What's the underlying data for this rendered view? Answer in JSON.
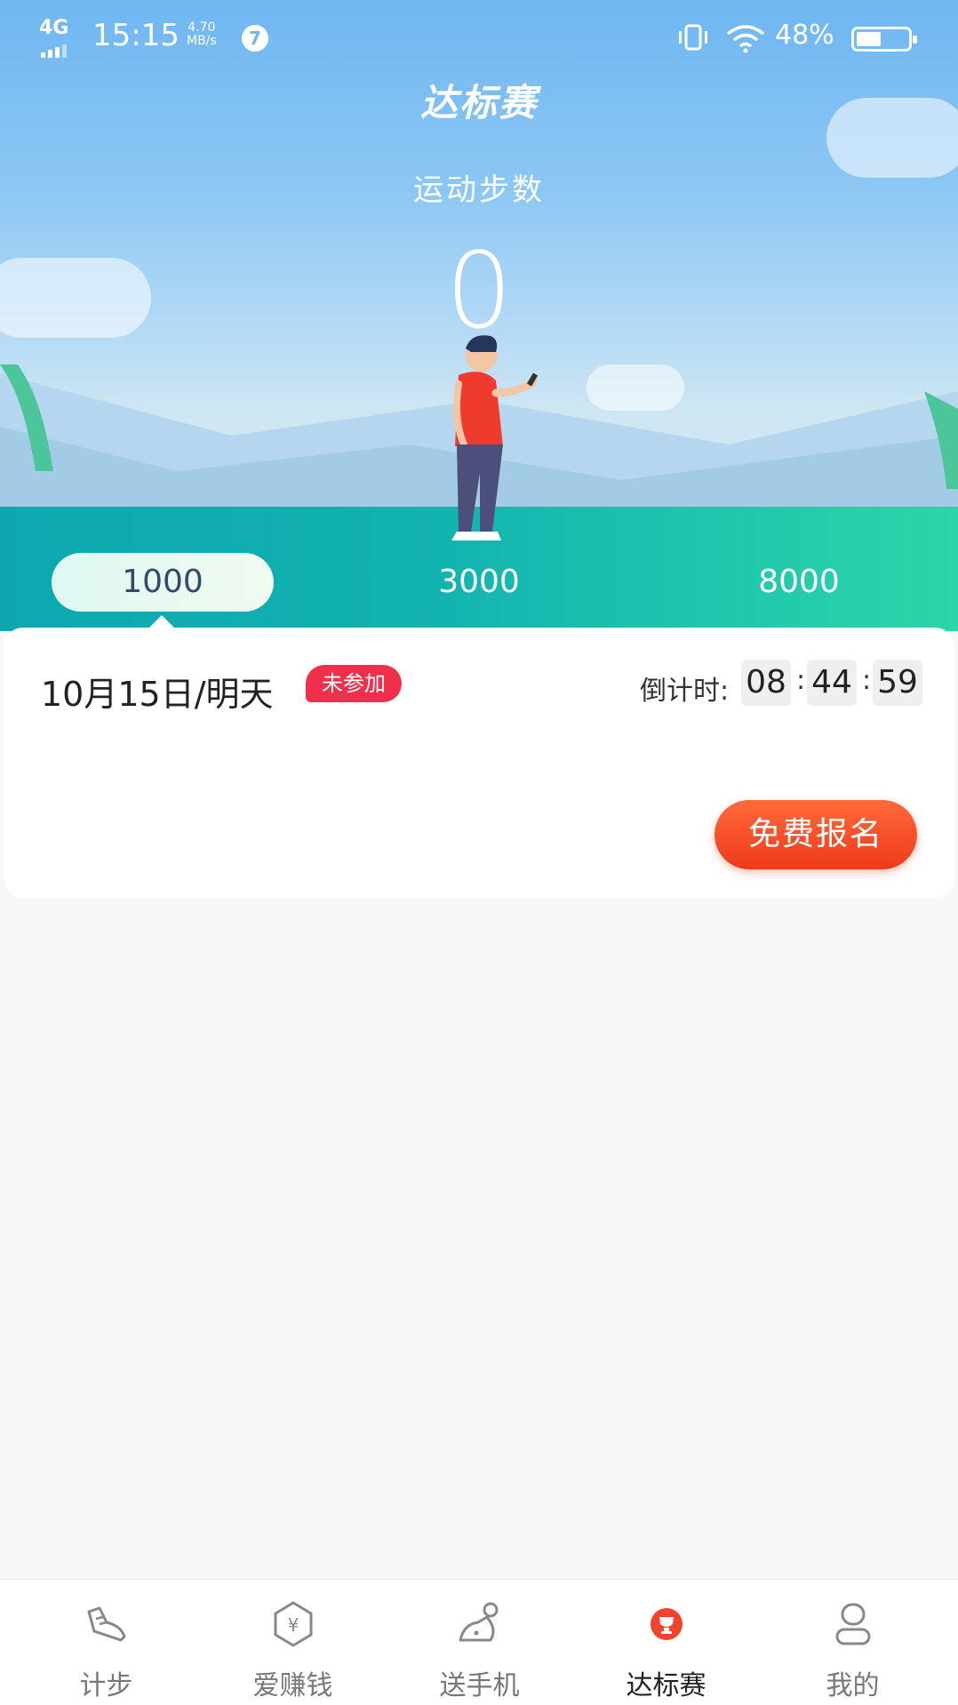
{
  "status_bar": {
    "network": "4G",
    "time": "15:15",
    "speed_value": "4.70",
    "speed_unit": "MB/s",
    "notification_count": "7",
    "battery_percent": "48%",
    "battery_level": 0.48
  },
  "header": {
    "title": "达标赛"
  },
  "steps": {
    "label": "运动步数",
    "value": "0"
  },
  "targets": [
    {
      "label": "1000",
      "active": true
    },
    {
      "label": "3000",
      "active": false
    },
    {
      "label": "8000",
      "active": false
    }
  ],
  "challenge_card": {
    "date": "10月15日/明天",
    "status": "未参加",
    "countdown_label": "倒计时:",
    "countdown": {
      "hours": "08",
      "minutes": "44",
      "seconds": "59"
    },
    "separator": ":",
    "signup_button": "免费报名"
  },
  "bottom_nav": {
    "items": [
      {
        "label": "计步",
        "icon": "shoe-icon",
        "active": false
      },
      {
        "label": "爱赚钱",
        "icon": "yuan-coin-icon",
        "active": false
      },
      {
        "label": "送手机",
        "icon": "phone-gift-icon",
        "active": false
      },
      {
        "label": "达标赛",
        "icon": "trophy-icon",
        "active": true
      },
      {
        "label": "我的",
        "icon": "user-icon",
        "active": false
      }
    ]
  },
  "colors": {
    "accent_red": "#f0304a",
    "button_orange": "#f04a20",
    "sky_blue": "#6fb6f1",
    "ground_teal": "#12b3b0"
  }
}
